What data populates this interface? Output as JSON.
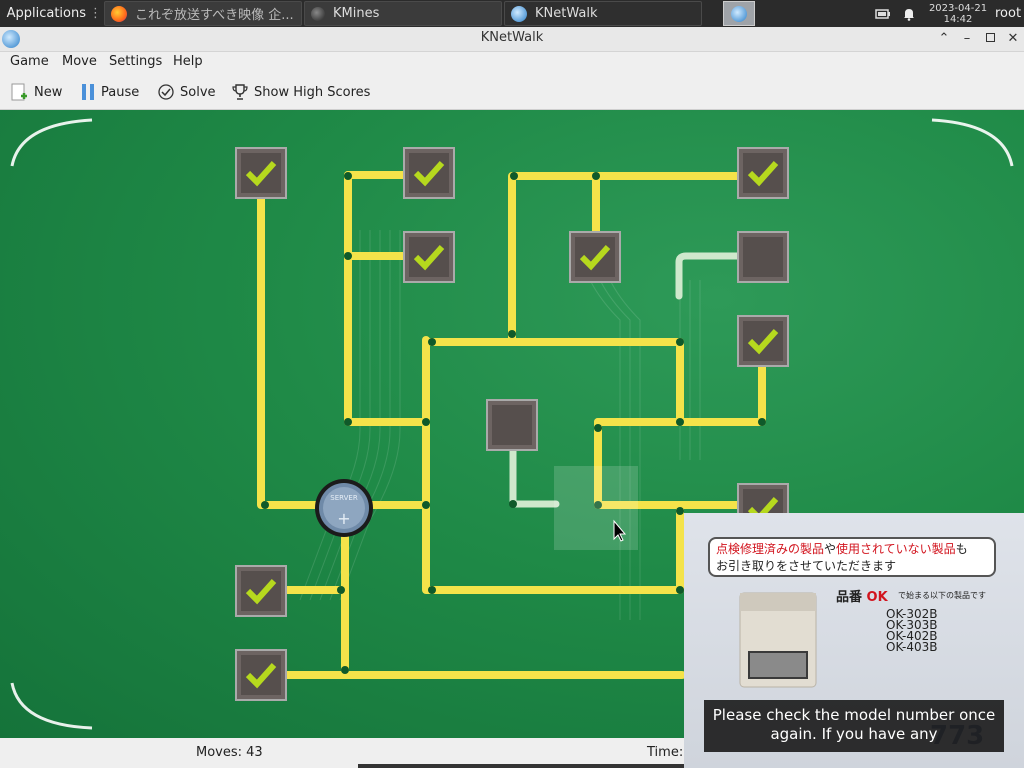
{
  "taskbar": {
    "applications_label": "Applications",
    "tasks": [
      {
        "label": "これぞ放送すべき映像 企...",
        "icon": "firefox-icon"
      },
      {
        "label": "KMines",
        "icon": "kmines-icon"
      },
      {
        "label": "KNetWalk",
        "icon": "knetwalk-icon"
      }
    ],
    "date": "2023-04-21",
    "time": "14:42",
    "user": "root"
  },
  "window": {
    "title": "KNetWalk"
  },
  "menu": {
    "game": "Game",
    "move": "Move",
    "settings": "Settings",
    "help": "Help"
  },
  "toolbar": {
    "new": "New",
    "pause": "Pause",
    "solve": "Solve",
    "high_scores": "Show High Scores"
  },
  "status": {
    "moves": "Moves: 43",
    "time": "Time:"
  },
  "board": {
    "server_label": "SERVER",
    "colors": {
      "cable_connected": "#f4e34a",
      "cable_disconnected": "#cfe8cc",
      "check": "#b6d91e"
    }
  },
  "video": {
    "bubble_red1": "点検修理済みの製品",
    "bubble_mid": "や",
    "bubble_red2": "使用されていない製品",
    "bubble_end": "も",
    "bubble_line2": "お引き取りをさせていただきます",
    "hinban": "品番",
    "ok": "OK",
    "hinban_sub": "で始まる以下の製品です",
    "models": [
      "OK-302B",
      "OK-303B",
      "OK-402B",
      "OK-403B"
    ],
    "caption": "Please check the model number once again. If you have any",
    "bg_number": "773"
  }
}
